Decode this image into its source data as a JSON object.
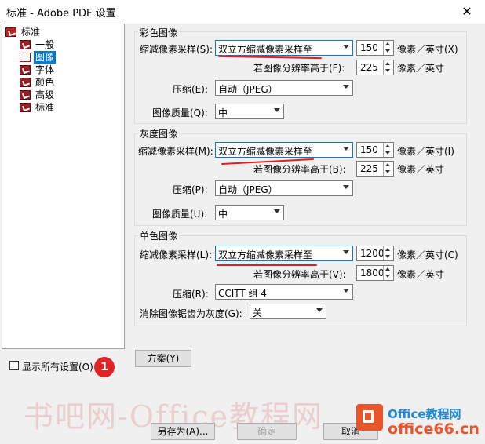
{
  "window": {
    "title": "标准 - Adobe PDF 设置",
    "close_glyph": "✕"
  },
  "tree": {
    "root": "标准",
    "items": [
      "一般",
      "图像",
      "字体",
      "颜色",
      "高级",
      "标准"
    ],
    "selected_index": 1
  },
  "color_image": {
    "title": "彩色图像",
    "downsample_label": "缩减像素采样(S):",
    "downsample_value": "双立方缩减像素采样至",
    "resolution": "150",
    "unit_label": "像素／英寸(X)",
    "above_label": "若图像分辨率高于(F):",
    "above_value": "225",
    "above_unit": "像素／英寸",
    "compression_label": "压缩(E):",
    "compression_value": "自动（JPEG）",
    "quality_label": "图像质量(Q):",
    "quality_value": "中"
  },
  "gray_image": {
    "title": "灰度图像",
    "downsample_label": "缩减像素采样(M):",
    "downsample_value": "双立方缩减像素采样至",
    "resolution": "150",
    "unit_label": "像素／英寸(I)",
    "above_label": "若图像分辨率高于(B):",
    "above_value": "225",
    "above_unit": "像素／英寸",
    "compression_label": "压缩(P):",
    "compression_value": "自动（JPEG）",
    "quality_label": "图像质量(U):",
    "quality_value": "中"
  },
  "mono_image": {
    "title": "单色图像",
    "downsample_label": "缩减像素采样(L):",
    "downsample_value": "双立方缩减像素采样至",
    "resolution": "1200",
    "unit_label": "像素／英寸(C)",
    "above_label": "若图像分辨率高于(V):",
    "above_value": "1800",
    "above_unit": "像素／英寸",
    "compression_label": "压缩(R):",
    "compression_value": "CCITT 组 4",
    "antialias_label": "消除图像锯齿为灰度(G):",
    "antialias_value": "关"
  },
  "show_all_label": "显示所有设置(O)",
  "badge": "1",
  "buttons": {
    "scheme": "方案(Y)",
    "save_as": "另存为(A)...",
    "ok": "确定",
    "cancel": "取消"
  },
  "watermark": {
    "text": "书吧网-Office教程网",
    "site_line1": "Office教程网",
    "site_line2": "office66.cn"
  },
  "colors": {
    "accent": "#0078d7",
    "annotation_red": "#e02020"
  }
}
